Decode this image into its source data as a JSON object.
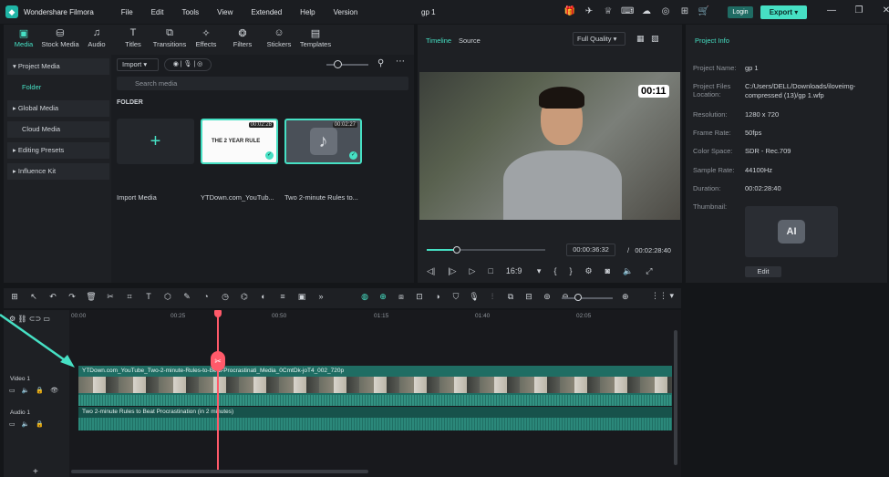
{
  "titlebar": {
    "app_title": "Wondershare Filmora",
    "menu": [
      "File",
      "Edit",
      "Tools",
      "View",
      "Extended",
      "Help",
      "Version"
    ],
    "project_name": "gp 1",
    "login_label": "Login",
    "export_label": "Export"
  },
  "media": {
    "tabs": [
      {
        "label": "Media",
        "icon": "media-icon"
      },
      {
        "label": "Stock Media",
        "icon": "stock-media-icon"
      },
      {
        "label": "Audio",
        "icon": "audio-icon"
      },
      {
        "label": "Titles",
        "icon": "titles-icon"
      },
      {
        "label": "Transitions",
        "icon": "transitions-icon"
      },
      {
        "label": "Effects",
        "icon": "effects-icon"
      },
      {
        "label": "Filters",
        "icon": "filters-icon"
      },
      {
        "label": "Stickers",
        "icon": "stickers-icon"
      },
      {
        "label": "Templates",
        "icon": "templates-icon"
      }
    ],
    "nav": [
      "Project Media",
      "Folder",
      "Global Media",
      "Cloud Media",
      "Editing Presets",
      "Influence Kit"
    ],
    "import_label": "Import",
    "search_placeholder": "Search media",
    "folder_label": "FOLDER",
    "import_media_label": "Import Media",
    "clips": [
      {
        "label": "YTDown.com_YouTub...",
        "duration": "00:02:28",
        "thumb_text": "THE 2 YEAR RULE"
      },
      {
        "label": "Two 2-minute Rules to...",
        "duration": "00:02:27"
      }
    ]
  },
  "player": {
    "tab_timeline": "Timeline",
    "tab_source": "Source",
    "quality": "Full Quality",
    "overlay_timer": "00:11",
    "current_time": "00:00:36:32",
    "separator": "/",
    "total_time": "00:02:28:40",
    "aspect": "16:9",
    "progress": 0.25
  },
  "info": {
    "title": "Project Info",
    "rows": [
      {
        "label": "Project Name:",
        "value": "gp 1"
      },
      {
        "label": "Project Files Location:",
        "value": "C:/Users/DELL/Downloads/iloveimg-compressed (13)/gp 1.wfp"
      },
      {
        "label": "Resolution:",
        "value": "1280 x 720"
      },
      {
        "label": "Frame Rate:",
        "value": "50fps"
      },
      {
        "label": "Color Space:",
        "value": "SDR - Rec.709"
      },
      {
        "label": "Sample Rate:",
        "value": "44100Hz"
      },
      {
        "label": "Duration:",
        "value": "00:02:28:40"
      },
      {
        "label": "Thumbnail:",
        "value": ""
      }
    ],
    "thumbnail_text": "AI",
    "edit_label": "Edit"
  },
  "timeline": {
    "ruler": [
      "00:00",
      "00:25",
      "00:50",
      "01:15",
      "01:40",
      "02:05"
    ],
    "video_track": "Video 1",
    "audio_track": "Audio 1",
    "video_clip_title": "YTDown.com_YouTube_Two-2-minute-Rules-to-Beat-Procrastinati_Media_0CmtDk-joT4_002_720p",
    "audio_clip_title": "Two 2-minute Rules to Beat Procrastination (in 2 minutes)"
  },
  "colors": {
    "accent": "#46e0c4",
    "playhead": "#ff5a6a"
  }
}
